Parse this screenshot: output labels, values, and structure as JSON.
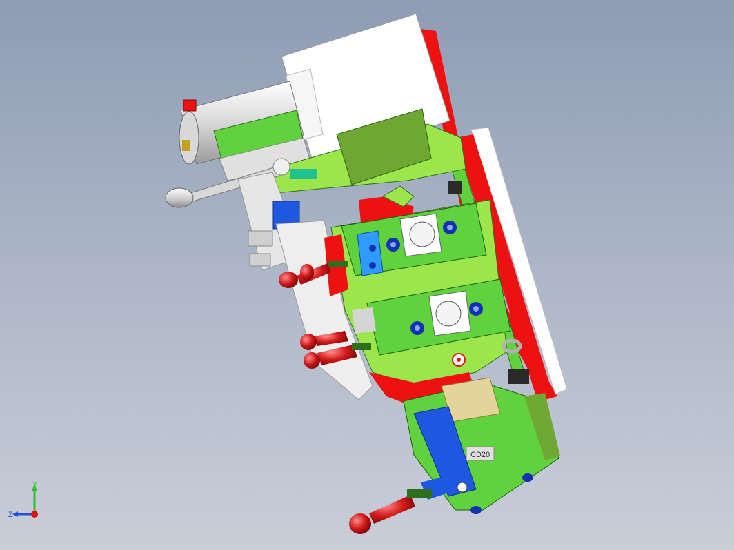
{
  "viewport": {
    "background_top": "#8e9cb4",
    "background_bottom": "#c9ced8"
  },
  "model": {
    "colors": {
      "frame_green": "#5fd23e",
      "light_green": "#9be64a",
      "dark_green": "#5a9a2a",
      "olive": "#6ea832",
      "red": "#ee1111",
      "white": "#ffffff",
      "blue": "#1e58e0",
      "navy": "#1432b0",
      "grey": "#d4d4d4",
      "handle_red": "#d21a1a",
      "tan": "#e2d49a"
    },
    "parts": [
      "cylinder",
      "cover-plate",
      "back-plate",
      "clamp-arm",
      "locating-block-upper",
      "locating-block-lower",
      "toggle-handle",
      "lever-handle",
      "bracket-lower"
    ],
    "badge_text": "CD20"
  },
  "triad": {
    "y_label": "Y",
    "z_label": "Z",
    "y_color": "#2fbf2f",
    "z_color": "#2050e0",
    "origin_color": "#e01010"
  }
}
